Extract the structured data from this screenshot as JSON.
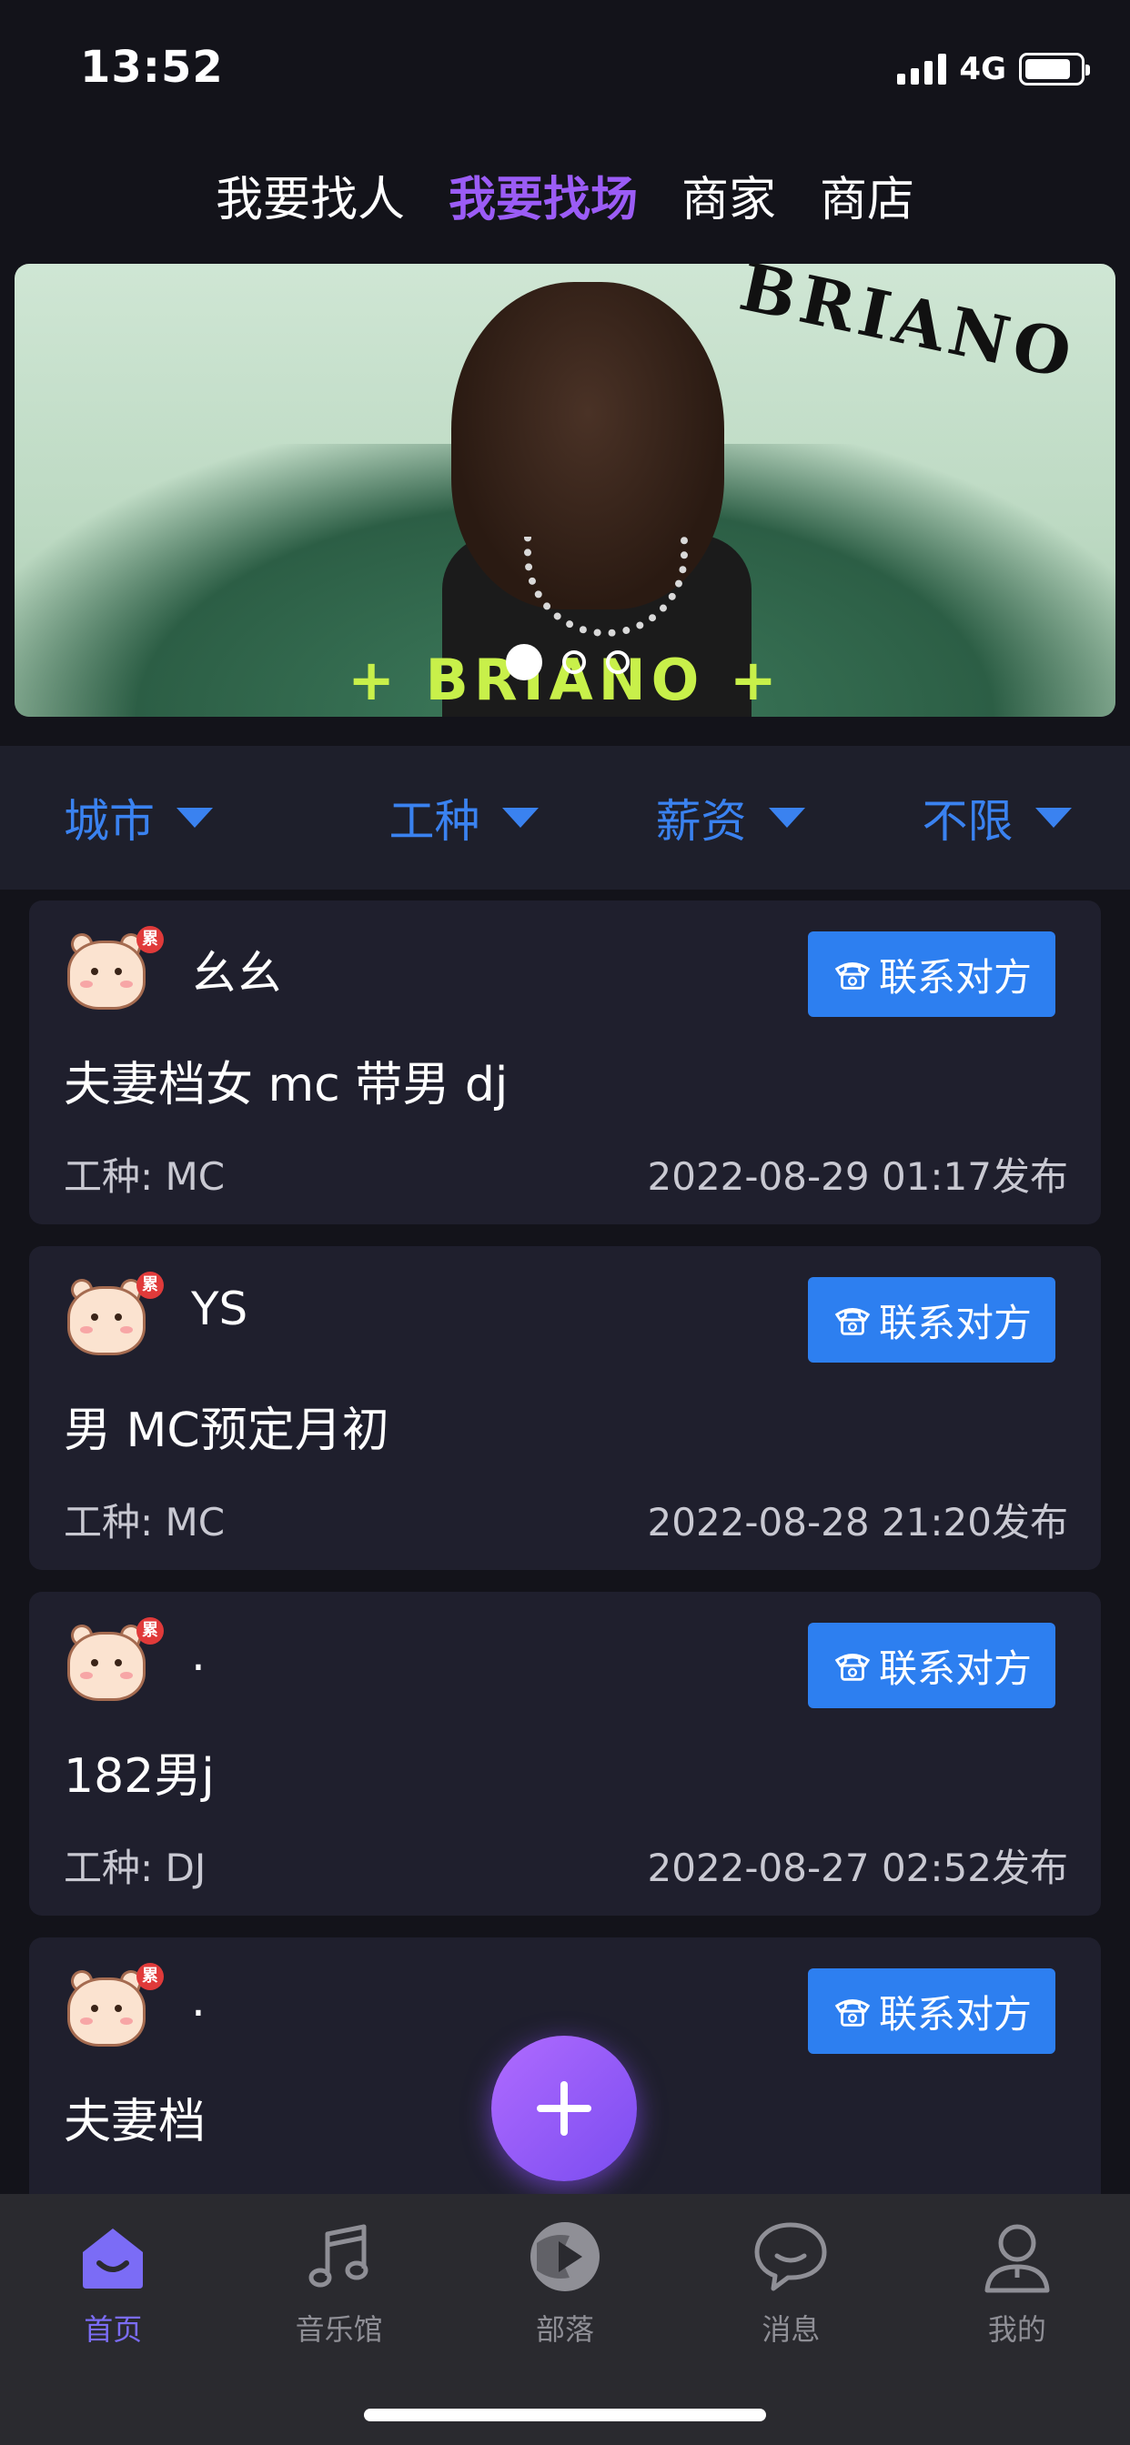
{
  "status_bar": {
    "time": "13:52",
    "network": "4G",
    "battery_level": 0.85
  },
  "top_tabs": [
    {
      "label": "我要找人",
      "active": false
    },
    {
      "label": "我要找场",
      "active": true
    },
    {
      "label": "商家",
      "active": false
    },
    {
      "label": "商店",
      "active": false
    }
  ],
  "banner": {
    "brand": "BRIANO",
    "bottom_text": "+ BRIANO +",
    "slide_count": 3,
    "active_slide": 1
  },
  "filters": [
    {
      "label": "城市"
    },
    {
      "label": "工种"
    },
    {
      "label": "薪资"
    },
    {
      "label": "不限"
    }
  ],
  "cards": [
    {
      "username": "幺幺",
      "title": "夫妻档女 mc 带男 dj",
      "job": "工种:  MC",
      "date": "2022-08-29 01:17发布",
      "contact_label": "联系对方",
      "badge": "累"
    },
    {
      "username": "YS",
      "title": "男 MC预定月初",
      "job": "工种:  MC",
      "date": "2022-08-28 21:20发布",
      "contact_label": "联系对方",
      "badge": "累"
    },
    {
      "username": ".",
      "title": "182男j",
      "job": "工种:  DJ",
      "date": "2022-08-27 02:52发布",
      "contact_label": "联系对方",
      "badge": "累"
    },
    {
      "username": ".",
      "title": "夫妻档",
      "job": "",
      "date": "",
      "contact_label": "联系对方",
      "badge": "累"
    }
  ],
  "bottom_nav": [
    {
      "label": "首页",
      "icon": "home-icon",
      "active": true
    },
    {
      "label": "音乐馆",
      "icon": "music-note-icon",
      "active": false
    },
    {
      "label": "部落",
      "icon": "play-circle-icon",
      "active": false
    },
    {
      "label": "消息",
      "icon": "chat-bubble-icon",
      "active": false
    },
    {
      "label": "我的",
      "icon": "user-icon",
      "active": false
    }
  ],
  "colors": {
    "accent_purple": "#9b5cf6",
    "accent_blue": "#2d7ff0",
    "filter_blue": "#3a82f0",
    "background": "#13131a",
    "card_bg": "#1f1f2d"
  }
}
